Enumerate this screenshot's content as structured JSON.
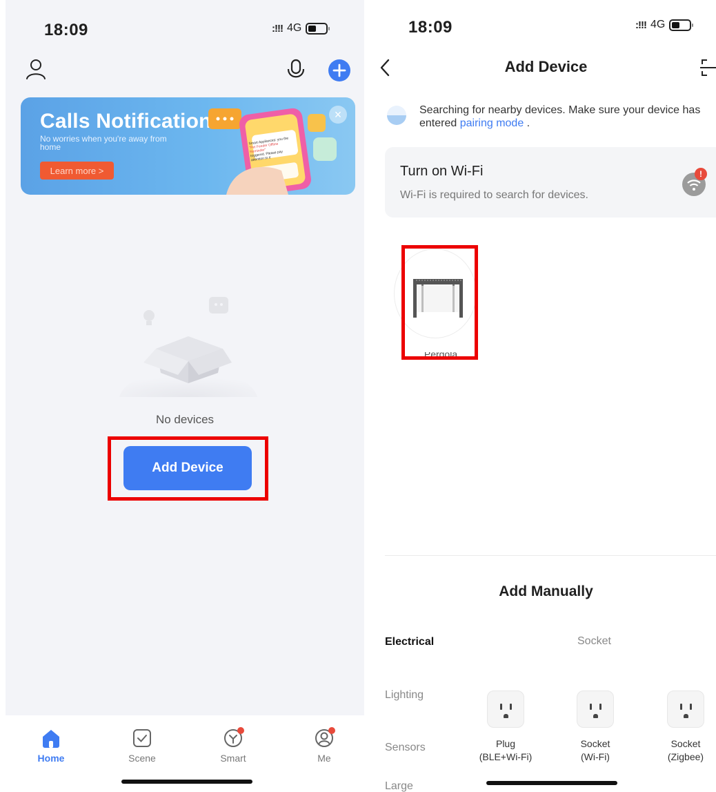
{
  "left_screen": {
    "status_bar": {
      "time": "18:09",
      "signal": ":!!!",
      "network": "4G"
    },
    "banner": {
      "title": "Calls Notification",
      "subtitle": "No worries when you're away from home",
      "learn_more": "Learn more >",
      "close": "×",
      "phone_text_1": "Smart Appliances: you the",
      "phone_text_2": "\"Pet Feeder Offline Reminder\"",
      "phone_text_3": "triggered. Please pay attention to it"
    },
    "empty_state": {
      "text": "No devices"
    },
    "add_device_button": "Add Device",
    "tabbar": [
      {
        "label": "Home",
        "icon": "home-icon",
        "active": true
      },
      {
        "label": "Scene",
        "icon": "scene-icon",
        "active": false
      },
      {
        "label": "Smart",
        "icon": "smart-icon",
        "active": false,
        "badge": true
      },
      {
        "label": "Me",
        "icon": "me-icon",
        "active": false,
        "badge": true
      }
    ]
  },
  "right_screen": {
    "status_bar": {
      "time": "18:09",
      "signal": ":!!!",
      "network": "4G"
    },
    "nav": {
      "title": "Add Device"
    },
    "search": {
      "text_before": "Searching for nearby devices. Make sure your device has entered ",
      "link": "pairing mode",
      "text_after": " ."
    },
    "wifi_card": {
      "title": "Turn on Wi-Fi",
      "subtitle": "Wi-Fi is required to search for devices.",
      "badge": "!"
    },
    "found_device": {
      "label": "Pergola"
    },
    "add_manually": {
      "title": "Add Manually",
      "categories": [
        "Electrical",
        "Lighting",
        "Sensors",
        "Large"
      ],
      "section_label": "Socket",
      "items": [
        {
          "line1": "Plug",
          "line2": "(BLE+Wi-Fi)"
        },
        {
          "line1": "Socket",
          "line2": "(Wi-Fi)"
        },
        {
          "line1": "Socket",
          "line2": "(Zigbee)"
        }
      ]
    }
  },
  "colors": {
    "accent": "#3f7cf2",
    "highlight": "#ec0000",
    "badge": "#e84a3b",
    "banner": "#6cb7ef"
  }
}
